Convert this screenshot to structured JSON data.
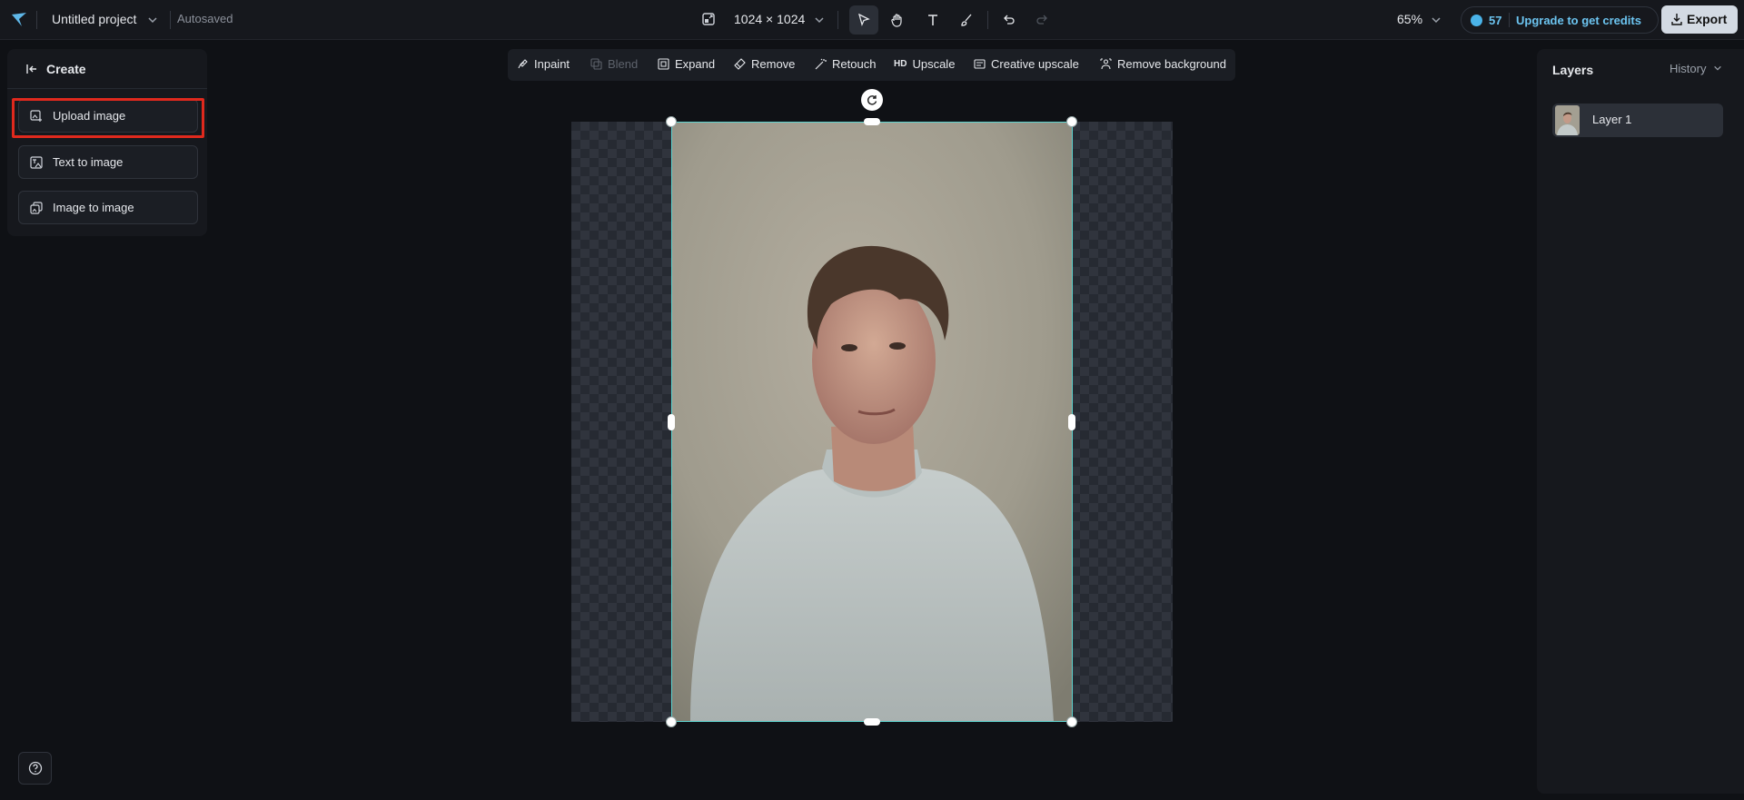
{
  "header": {
    "project_title": "Untitled project",
    "save_status": "Autosaved",
    "canvas_width": "1024",
    "size_separator": "×",
    "canvas_height": "1024",
    "zoom": "65%",
    "credits": "57",
    "upgrade_label": "Upgrade to get credits",
    "export_label": "Export"
  },
  "create_panel": {
    "title": "Create",
    "buttons": [
      {
        "label": "Upload image",
        "icon": "upload-image-icon",
        "highlighted": true
      },
      {
        "label": "Text to image",
        "icon": "text-to-image-icon"
      },
      {
        "label": "Image to image",
        "icon": "image-to-image-icon"
      }
    ]
  },
  "edit_toolbar": {
    "items": [
      {
        "label": "Inpaint",
        "icon": "inpaint-icon",
        "enabled": true
      },
      {
        "label": "Blend",
        "icon": "blend-icon",
        "enabled": false
      },
      {
        "label": "Expand",
        "icon": "expand-icon",
        "enabled": true
      },
      {
        "label": "Remove",
        "icon": "eraser-icon",
        "enabled": true
      },
      {
        "label": "Retouch",
        "icon": "magic-wand-icon",
        "enabled": true
      },
      {
        "label": "Upscale",
        "badge": "HD",
        "enabled": true
      },
      {
        "label": "Creative upscale",
        "icon": "creative-upscale-icon",
        "enabled": true
      },
      {
        "label": "Remove background",
        "icon": "remove-background-icon",
        "enabled": true
      }
    ]
  },
  "layers_panel": {
    "title": "Layers",
    "history_label": "History",
    "layers": [
      {
        "name": "Layer 1"
      }
    ]
  },
  "colors": {
    "accent": "#6cc4f0",
    "selection": "#5fd4cf",
    "highlight": "#e0291d"
  }
}
